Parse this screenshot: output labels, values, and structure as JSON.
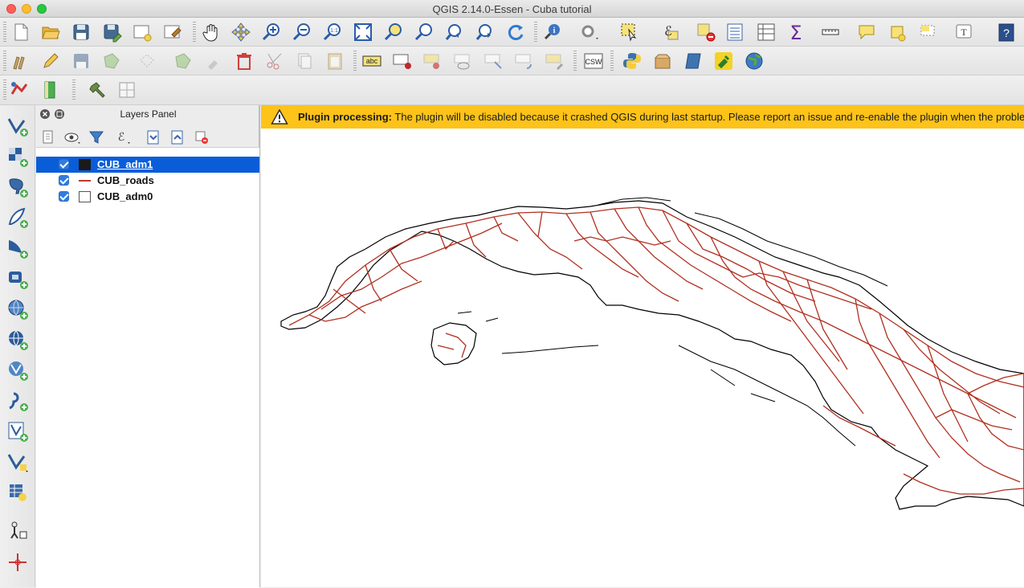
{
  "window": {
    "title": "QGIS 2.14.0-Essen - Cuba tutorial"
  },
  "layers_panel": {
    "title": "Layers Panel",
    "layers": [
      {
        "name": "CUB_adm1",
        "checked": true,
        "selected": true,
        "symbol": "fill-polygon",
        "color": "#1a1a1a"
      },
      {
        "name": "CUB_roads",
        "checked": true,
        "selected": false,
        "symbol": "line",
        "color": "#c0392b"
      },
      {
        "name": "CUB_adm0",
        "checked": true,
        "selected": false,
        "symbol": "empty-polygon",
        "color": "#ffffff"
      }
    ]
  },
  "message_bar": {
    "icon": "warning-icon",
    "title": "Plugin processing:",
    "text": " The plugin will be disabled because it crashed QGIS during last startup. Please report an issue and re-enable the plugin when the proble"
  },
  "toolbar": {
    "label_tool_text": "abc",
    "csw_text": "CSW",
    "text_annotation_text": "T"
  },
  "colors": {
    "selection": "#0a5dd8",
    "warning": "#fdc318",
    "roads": "#b03020",
    "outline": "#000000"
  }
}
